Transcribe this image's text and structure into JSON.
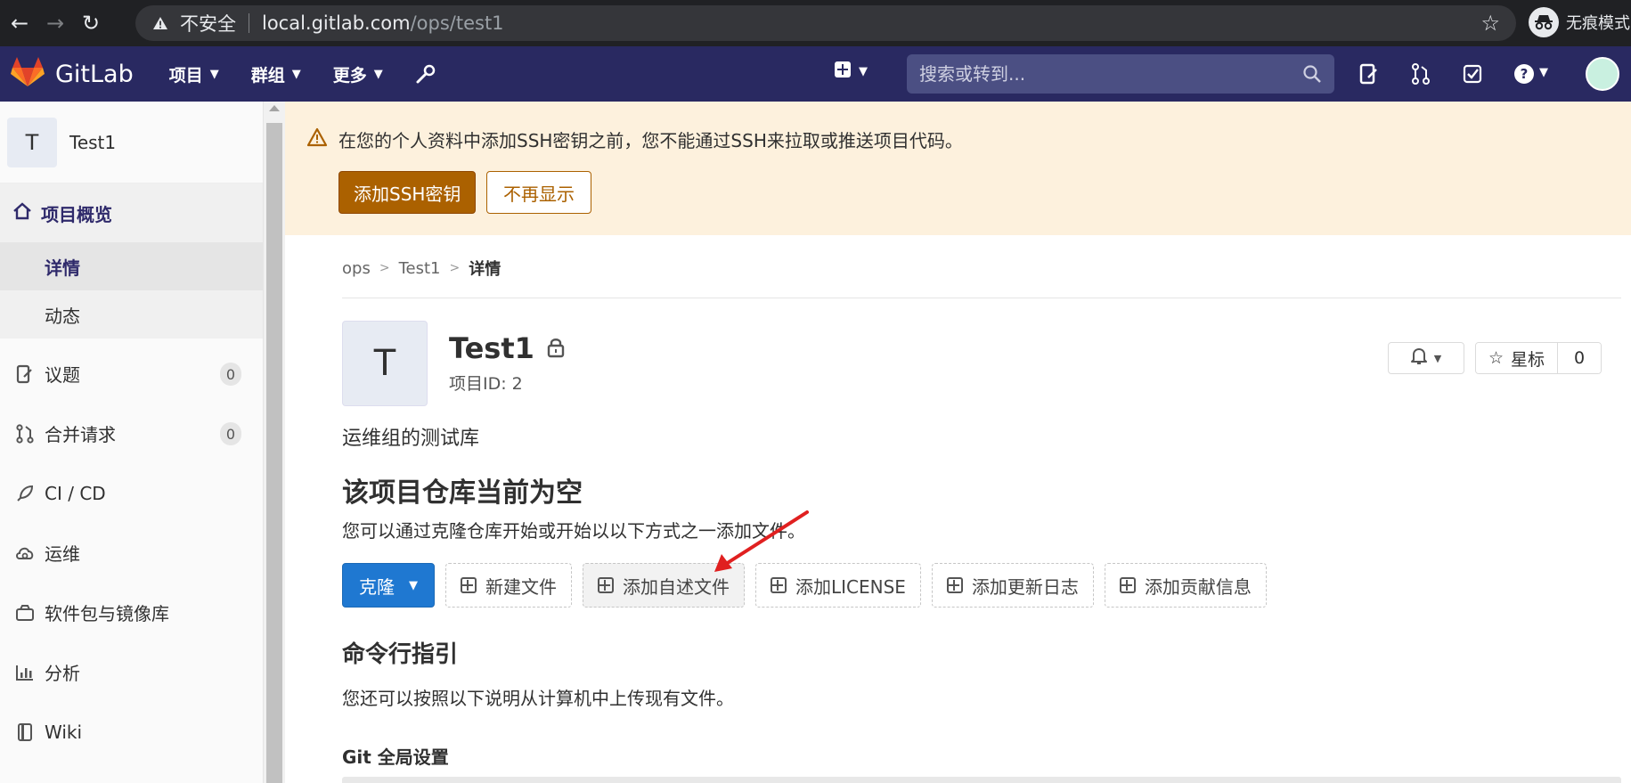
{
  "browser": {
    "security_label": "不安全",
    "url_host": "local.gitlab.com",
    "url_path": "/ops/test1",
    "incognito_label": "无痕模式"
  },
  "header": {
    "brand": "GitLab",
    "nav": [
      {
        "label": "项目"
      },
      {
        "label": "群组"
      },
      {
        "label": "更多"
      }
    ],
    "search_placeholder": "搜索或转到..."
  },
  "sidebar": {
    "project_avatar_letter": "T",
    "project_name": "Test1",
    "overview_label": "项目概览",
    "overview_sub": [
      {
        "label": "详情"
      },
      {
        "label": "动态"
      }
    ],
    "items": [
      {
        "label": "议题",
        "count": "0",
        "icon": "issues-icon"
      },
      {
        "label": "合并请求",
        "count": "0",
        "icon": "merge-request-icon"
      },
      {
        "label": "CI / CD",
        "icon": "rocket-icon"
      },
      {
        "label": "运维",
        "icon": "cloud-gear-icon"
      },
      {
        "label": "软件包与镜像库",
        "icon": "package-icon"
      },
      {
        "label": "分析",
        "icon": "chart-icon"
      },
      {
        "label": "Wiki",
        "icon": "book-icon"
      }
    ]
  },
  "banner": {
    "message": "在您的个人资料中添加SSH密钥之前，您不能通过SSH来拉取或推送项目代码。",
    "add_ssh_label": "添加SSH密钥",
    "dismiss_label": "不再显示"
  },
  "breadcrumb": [
    "ops",
    "Test1",
    "详情"
  ],
  "project": {
    "avatar_letter": "T",
    "title": "Test1",
    "id_label": "项目ID: 2",
    "star_label": "星标",
    "star_count": "0",
    "description": "运维组的测试库"
  },
  "empty_repo": {
    "heading": "该项目仓库当前为空",
    "text": "您可以通过克隆仓库开始或开始以以下方式之一添加文件。",
    "clone_label": "克隆",
    "buttons": [
      "新建文件",
      "添加自述文件",
      "添加LICENSE",
      "添加更新日志",
      "添加贡献信息"
    ]
  },
  "cli": {
    "heading": "命令行指引",
    "text": "您还可以按照以下说明从计算机中上传现有文件。",
    "git_global_heading": "Git 全局设置"
  },
  "colors": {
    "header_bg": "#292961",
    "banner_bg": "#fdf1dd",
    "warning_btn": "#ab6100",
    "primary_btn": "#1f78d1",
    "annotation_arrow": "#e02020"
  }
}
